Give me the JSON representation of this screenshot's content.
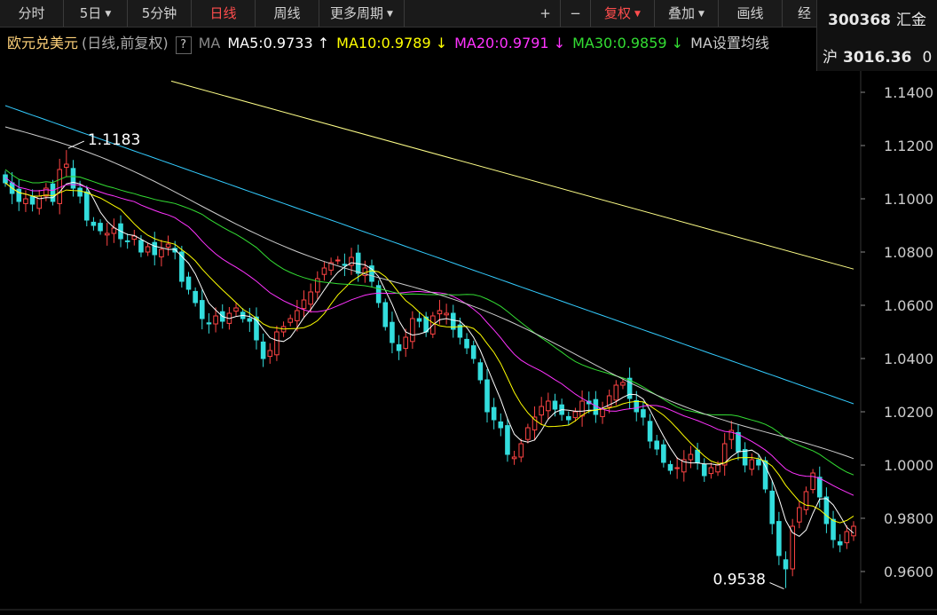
{
  "toolbar": {
    "items": [
      {
        "label": "分时",
        "caret": false,
        "active": false
      },
      {
        "label": "5日",
        "caret": true,
        "active": false
      },
      {
        "label": "5分钟",
        "caret": false,
        "active": false
      },
      {
        "label": "日线",
        "caret": false,
        "active": true
      },
      {
        "label": "周线",
        "caret": false,
        "active": false
      },
      {
        "label": "更多周期",
        "caret": true,
        "active": false
      },
      {
        "label": "+",
        "caret": false,
        "active": false
      },
      {
        "label": "−",
        "caret": false,
        "active": false
      },
      {
        "label": "复权",
        "caret": true,
        "active": true
      },
      {
        "label": "叠加",
        "caret": true,
        "active": false
      },
      {
        "label": "画线",
        "caret": false,
        "active": false
      },
      {
        "label": "经",
        "caret": false,
        "active": false
      }
    ]
  },
  "ticker": {
    "code": "300368",
    "name": "汇金",
    "index_label": "沪",
    "index_value": "3016.36",
    "trail": "0"
  },
  "ma_header": {
    "title": "欧元兑美元",
    "subtitle": "(日线,前复权)",
    "help": "?",
    "ma_label": "MA",
    "ma5": "MA5:0.9733 ↑",
    "ma10": "MA10:0.9789 ↓",
    "ma20": "MA20:0.9791 ↓",
    "ma30": "MA30:0.9859 ↓",
    "ma_more": "MA",
    "settings": "设置均线",
    "colors": {
      "ma5": "#ffffff",
      "ma10": "#ffff00",
      "ma20": "#ff33ff",
      "ma30": "#33dd33",
      "title": "#ffd27a"
    }
  },
  "chart_data": {
    "type": "candlestick",
    "y_ticks": [
      "1.1400",
      "1.1200",
      "1.1000",
      "1.0800",
      "1.0600",
      "1.0400",
      "1.0200",
      "1.0000",
      "0.9800",
      "0.9600"
    ],
    "ylim": [
      0.948,
      1.148
    ],
    "high_label": "1.1183",
    "low_label": "0.9538",
    "high_value": 1.1183,
    "low_value": 0.9538,
    "closes": [
      1.106,
      1.102,
      1.099,
      1.1,
      1.098,
      1.101,
      1.104,
      1.099,
      1.111,
      1.113,
      1.104,
      1.101,
      1.092,
      1.09,
      1.088,
      1.087,
      1.089,
      1.085,
      1.084,
      1.086,
      1.08,
      1.082,
      1.079,
      1.081,
      1.083,
      1.08,
      1.069,
      1.066,
      1.061,
      1.055,
      1.053,
      1.056,
      1.054,
      1.057,
      1.059,
      1.055,
      1.054,
      1.047,
      1.04,
      1.043,
      1.05,
      1.052,
      1.055,
      1.058,
      1.062,
      1.065,
      1.07,
      1.074,
      1.076,
      1.077,
      1.075,
      1.078,
      1.072,
      1.074,
      1.069,
      1.061,
      1.052,
      1.046,
      1.043,
      1.048,
      1.055,
      1.054,
      1.05,
      1.056,
      1.058,
      1.057,
      1.051,
      1.048,
      1.044,
      1.04,
      1.032,
      1.02,
      1.017,
      1.014,
      1.004,
      1.003,
      1.008,
      1.014,
      1.018,
      1.022,
      1.024,
      1.021,
      1.019,
      1.017,
      1.02,
      1.024,
      1.023,
      1.019,
      1.021,
      1.026,
      1.03,
      1.031,
      1.025,
      1.02,
      1.018,
      1.009,
      1.006,
      1.001,
      0.998,
      0.999,
      1.002,
      1.004,
      1.001,
      0.996,
      0.999,
      1.0,
      1.008,
      1.013,
      1.005,
      1.0,
      1.002,
      1.0,
      0.991,
      0.978,
      0.966,
      0.961,
      0.977,
      0.984,
      0.99,
      0.997,
      0.988,
      0.978,
      0.972,
      0.97,
      0.975,
      0.977
    ],
    "ma_colors": {
      "ma5": "#ffffff",
      "ma10": "#ffff00",
      "ma20": "#ff33ff",
      "ma30": "#33dd33",
      "ma60": "#cccccc",
      "ma120": "#33ccff",
      "ma250": "#ffff88"
    },
    "up_color": "#ff4444",
    "down_color": "#33dddd",
    "axis_color": "#cccccc"
  }
}
